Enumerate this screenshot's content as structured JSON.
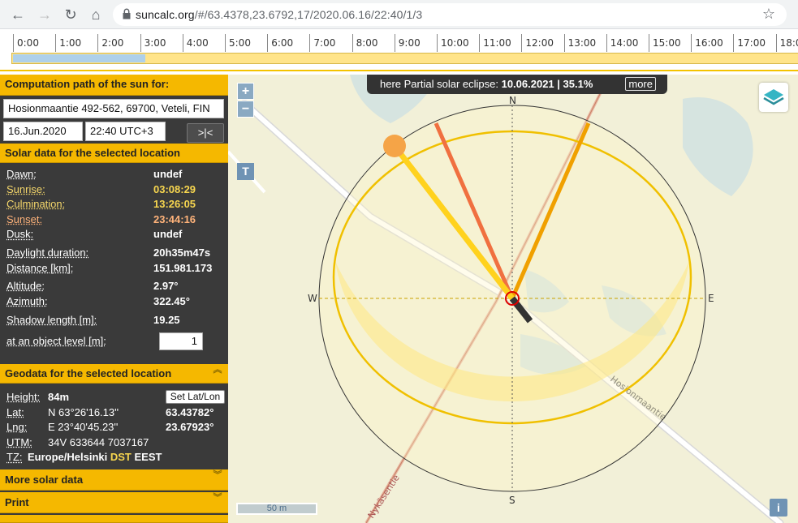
{
  "browser": {
    "url_host": "suncalc.org",
    "url_path": "/#/63.4378,23.6792,17/2020.06.16/22:40/1/3"
  },
  "timeline": {
    "hours": [
      "0:00",
      "1:00",
      "2:00",
      "3:00",
      "4:00",
      "5:00",
      "6:00",
      "7:00",
      "8:00",
      "9:00",
      "10:00",
      "11:00",
      "12:00",
      "13:00",
      "14:00",
      "15:00",
      "16:00",
      "17:00",
      "18:0"
    ],
    "night_fraction_shown": 0.168
  },
  "panel": {
    "header_path": "Computation path of the sun for:",
    "location": "Hosionmaantie 492-562, 69700, Veteli, FIN",
    "date": "16.Jun.2020",
    "time": "22:40 UTC+3",
    "now_button": ">|<",
    "header_solar": "Solar data for the selected location",
    "solar": [
      {
        "label": "Dawn:",
        "value": "undef",
        "style": ""
      },
      {
        "label": "Sunrise:",
        "value": "03:08:29",
        "style": "yel"
      },
      {
        "label": "Culmination:",
        "value": "13:26:05",
        "style": "yel"
      },
      {
        "label": "Sunset:",
        "value": "23:44:16",
        "style": "orn"
      },
      {
        "label": "Dusk:",
        "value": "undef",
        "style": ""
      }
    ],
    "solar2": [
      {
        "label": "Daylight duration:",
        "value": "20h35m47s"
      },
      {
        "label": "Distance [km]:",
        "value": "151.981.173"
      }
    ],
    "solar3": [
      {
        "label": "Altitude:",
        "value": "2.97°"
      },
      {
        "label": "Azimuth:",
        "value": "322.45°"
      }
    ],
    "shadow_label": "Shadow length [m]:",
    "shadow_value": "19.25",
    "object_label": "at an object level [m]:",
    "object_value": "1",
    "header_geo": "Geodata for the selected location",
    "height_label": "Height:",
    "height_value": "84m",
    "set_latlon": "Set Lat/Lon",
    "lat_label": "Lat:",
    "lat_dms": "N 63°26'16.13''",
    "lat_dec": "63.43782°",
    "lng_label": "Lng:",
    "lng_dms": "E 23°40'45.23''",
    "lng_dec": "23.67923°",
    "utm_label": "UTM:",
    "utm_value": "34V 633644 7037167",
    "tz_label": "TZ:",
    "tz_zone": "Europe/Helsinki",
    "tz_dst": "DST",
    "tz_abbr": "EEST",
    "header_more": "More solar data",
    "header_print": "Print"
  },
  "map": {
    "zoom_in": "+",
    "zoom_out": "−",
    "t_button": "T",
    "eclipse_prefix": "here Partial solar eclipse:",
    "eclipse_value": "10.06.2021 | 35.1%",
    "eclipse_more": "more",
    "compass": {
      "n": "N",
      "s": "S",
      "e": "E",
      "w": "W"
    },
    "road1": "Hosionmaantie",
    "road2": "Nykäsentie",
    "scale": "50 m",
    "info": "i",
    "colors": {
      "sun_path": "#f0c000",
      "sunrise": "#f0a000",
      "sunset": "#f07040",
      "current": "#ffd21e"
    }
  }
}
